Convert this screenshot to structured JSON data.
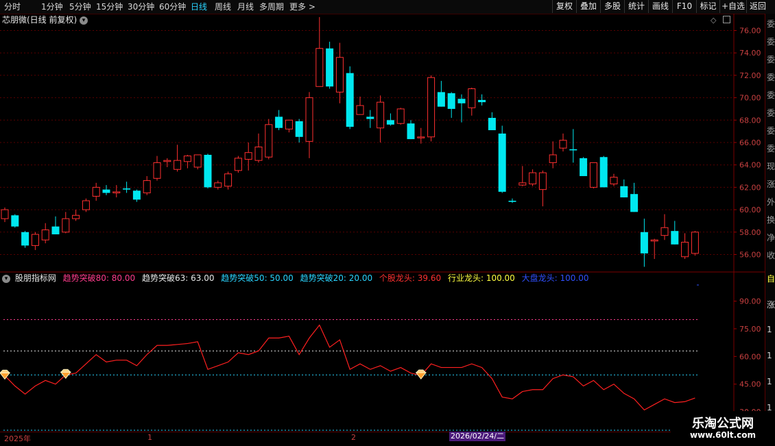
{
  "toolbar": {
    "left_items": [
      "分时",
      "1分钟",
      "5分钟",
      "15分钟",
      "30分钟",
      "60分钟",
      "日线",
      "周线",
      "月线",
      "多周期",
      "更多 >"
    ],
    "active": "日线",
    "right_items": [
      "复权",
      "叠加",
      "多股",
      "统计",
      "画线",
      "F10",
      "标记",
      "+自选",
      "返回"
    ]
  },
  "stock": {
    "title": "芯朋微(日线 前复权)"
  },
  "main_chart": {
    "y_ticks": [
      "76.00",
      "74.00",
      "72.00",
      "70.00",
      "68.00",
      "66.00",
      "64.00",
      "62.00",
      "60.00",
      "58.00",
      "56.00"
    ]
  },
  "indicator": {
    "name": "股朋指标网",
    "items": [
      {
        "label": "趋势突破80: 80.00",
        "color": "#ff3c8c"
      },
      {
        "label": "趋势突破63: 63.00",
        "color": "#e8e8e8"
      },
      {
        "label": "趋势突破50: 50.00",
        "color": "#2ad4ff"
      },
      {
        "label": "趋势突破20: 20.00",
        "color": "#2ad4ff"
      },
      {
        "label": "个股龙头: 39.60",
        "color": "#ff3030"
      },
      {
        "label": "行业龙头: 100.00",
        "color": "#ffff40"
      },
      {
        "label": "大盘龙头: 100.00",
        "color": "#3050ff"
      }
    ],
    "y_ticks": [
      "90.00",
      "75.00",
      "60.00",
      "45.00",
      "30.00"
    ]
  },
  "chart_data": {
    "type": "candlestick",
    "ylim": [
      54.5,
      77.5
    ],
    "candles": [
      {
        "o": 59.2,
        "h": 60.2,
        "l": 58.9,
        "c": 60.0
      },
      {
        "o": 59.5,
        "h": 59.6,
        "l": 58.4,
        "c": 58.5
      },
      {
        "o": 58.0,
        "h": 58.1,
        "l": 56.6,
        "c": 56.8
      },
      {
        "o": 56.8,
        "h": 58.0,
        "l": 56.4,
        "c": 57.8
      },
      {
        "o": 57.3,
        "h": 58.8,
        "l": 57.0,
        "c": 58.2
      },
      {
        "o": 58.5,
        "h": 59.4,
        "l": 57.8,
        "c": 57.8
      },
      {
        "o": 58.0,
        "h": 59.8,
        "l": 57.9,
        "c": 59.2
      },
      {
        "o": 59.2,
        "h": 60.0,
        "l": 59.0,
        "c": 59.5
      },
      {
        "o": 60.0,
        "h": 61.0,
        "l": 59.8,
        "c": 60.8
      },
      {
        "o": 61.2,
        "h": 62.4,
        "l": 60.8,
        "c": 62.0
      },
      {
        "o": 61.8,
        "h": 62.2,
        "l": 61.3,
        "c": 61.5
      },
      {
        "o": 61.5,
        "h": 62.2,
        "l": 61.1,
        "c": 61.6
      },
      {
        "o": 61.9,
        "h": 62.5,
        "l": 61.5,
        "c": 61.8
      },
      {
        "o": 61.7,
        "h": 61.8,
        "l": 60.7,
        "c": 60.9
      },
      {
        "o": 61.5,
        "h": 63.0,
        "l": 61.3,
        "c": 62.6
      },
      {
        "o": 62.8,
        "h": 64.8,
        "l": 62.6,
        "c": 64.2
      },
      {
        "o": 64.3,
        "h": 64.6,
        "l": 63.8,
        "c": 64.4
      },
      {
        "o": 63.6,
        "h": 65.8,
        "l": 63.4,
        "c": 64.4
      },
      {
        "o": 64.3,
        "h": 64.9,
        "l": 63.7,
        "c": 64.8
      },
      {
        "o": 63.8,
        "h": 64.9,
        "l": 63.6,
        "c": 64.9
      },
      {
        "o": 64.9,
        "h": 65.0,
        "l": 61.9,
        "c": 62.0
      },
      {
        "o": 62.0,
        "h": 62.6,
        "l": 61.8,
        "c": 62.4
      },
      {
        "o": 62.1,
        "h": 63.4,
        "l": 61.8,
        "c": 63.2
      },
      {
        "o": 63.5,
        "h": 64.8,
        "l": 63.3,
        "c": 64.6
      },
      {
        "o": 64.5,
        "h": 66.0,
        "l": 63.5,
        "c": 65.1
      },
      {
        "o": 64.4,
        "h": 66.8,
        "l": 64.2,
        "c": 65.6
      },
      {
        "o": 64.7,
        "h": 68.1,
        "l": 64.5,
        "c": 67.6
      },
      {
        "o": 68.3,
        "h": 68.9,
        "l": 67.1,
        "c": 67.3
      },
      {
        "o": 67.2,
        "h": 68.0,
        "l": 66.9,
        "c": 68.0
      },
      {
        "o": 67.9,
        "h": 68.1,
        "l": 66.0,
        "c": 66.5
      },
      {
        "o": 66.1,
        "h": 70.5,
        "l": 64.6,
        "c": 70.0
      },
      {
        "o": 71.0,
        "h": 77.2,
        "l": 71.0,
        "c": 74.4
      },
      {
        "o": 74.4,
        "h": 75.0,
        "l": 70.8,
        "c": 71.0
      },
      {
        "o": 70.5,
        "h": 74.9,
        "l": 69.5,
        "c": 73.6
      },
      {
        "o": 72.2,
        "h": 72.8,
        "l": 67.2,
        "c": 67.4
      },
      {
        "o": 68.5,
        "h": 70.1,
        "l": 68.5,
        "c": 69.3
      },
      {
        "o": 68.3,
        "h": 68.9,
        "l": 67.3,
        "c": 68.1
      },
      {
        "o": 67.3,
        "h": 70.2,
        "l": 66.0,
        "c": 69.6
      },
      {
        "o": 68.0,
        "h": 68.6,
        "l": 67.5,
        "c": 67.6
      },
      {
        "o": 67.7,
        "h": 69.1,
        "l": 67.6,
        "c": 69.0
      },
      {
        "o": 67.7,
        "h": 68.0,
        "l": 66.3,
        "c": 66.3
      },
      {
        "o": 66.5,
        "h": 67.3,
        "l": 65.9,
        "c": 66.5
      },
      {
        "o": 66.5,
        "h": 72.0,
        "l": 66.1,
        "c": 71.8
      },
      {
        "o": 70.5,
        "h": 71.5,
        "l": 69.2,
        "c": 69.2
      },
      {
        "o": 70.4,
        "h": 70.5,
        "l": 68.2,
        "c": 69.0
      },
      {
        "o": 69.9,
        "h": 70.3,
        "l": 67.8,
        "c": 69.5
      },
      {
        "o": 69.1,
        "h": 70.9,
        "l": 68.4,
        "c": 70.8
      },
      {
        "o": 69.8,
        "h": 70.3,
        "l": 69.3,
        "c": 69.6
      },
      {
        "o": 68.2,
        "h": 68.7,
        "l": 67.1,
        "c": 67.1
      },
      {
        "o": 66.8,
        "h": 67.5,
        "l": 61.5,
        "c": 61.6
      },
      {
        "o": 60.8,
        "h": 61.0,
        "l": 60.6,
        "c": 60.7
      },
      {
        "o": 62.2,
        "h": 63.9,
        "l": 62.1,
        "c": 62.4
      },
      {
        "o": 62.3,
        "h": 63.6,
        "l": 62.1,
        "c": 63.3
      },
      {
        "o": 61.8,
        "h": 63.5,
        "l": 60.3,
        "c": 63.3
      },
      {
        "o": 64.2,
        "h": 66.1,
        "l": 63.7,
        "c": 64.9
      },
      {
        "o": 65.5,
        "h": 66.8,
        "l": 65.2,
        "c": 66.2
      },
      {
        "o": 65.4,
        "h": 67.2,
        "l": 64.2,
        "c": 65.3
      },
      {
        "o": 64.6,
        "h": 64.7,
        "l": 63.0,
        "c": 63.0
      },
      {
        "o": 62.0,
        "h": 64.2,
        "l": 61.9,
        "c": 64.2
      },
      {
        "o": 64.7,
        "h": 64.8,
        "l": 62.0,
        "c": 62.0
      },
      {
        "o": 62.3,
        "h": 63.2,
        "l": 62.1,
        "c": 62.9
      },
      {
        "o": 62.1,
        "h": 62.7,
        "l": 61.1,
        "c": 61.1
      },
      {
        "o": 61.4,
        "h": 62.4,
        "l": 59.8,
        "c": 59.8
      },
      {
        "o": 58.0,
        "h": 59.2,
        "l": 54.9,
        "c": 56.1
      },
      {
        "o": 57.2,
        "h": 57.4,
        "l": 55.6,
        "c": 57.3
      },
      {
        "o": 57.7,
        "h": 59.6,
        "l": 57.3,
        "c": 58.4
      },
      {
        "o": 58.1,
        "h": 59.0,
        "l": 56.9,
        "c": 56.9
      },
      {
        "o": 55.8,
        "h": 57.9,
        "l": 55.6,
        "c": 57.1
      },
      {
        "o": 56.1,
        "h": 58.1,
        "l": 55.9,
        "c": 58.0
      }
    ],
    "indicator_ylim": [
      20,
      98
    ],
    "indicator_levels": [
      80,
      63,
      50,
      20
    ],
    "indicator_line": [
      49.6,
      44,
      39.6,
      44,
      47,
      45,
      50,
      51,
      56,
      61,
      57,
      58,
      58,
      55,
      61,
      66,
      66,
      66.5,
      67,
      68,
      53,
      55,
      57,
      62,
      61,
      63,
      70,
      70,
      71,
      61,
      70,
      77,
      65,
      69,
      53,
      56,
      53,
      55,
      52,
      54,
      51,
      49.7,
      56,
      54,
      54,
      54,
      56,
      54,
      48,
      38,
      37,
      41,
      42,
      42,
      48,
      50,
      49,
      44,
      47,
      42,
      45,
      40,
      37,
      31,
      34,
      37,
      35,
      35.5,
      37.5
    ],
    "diamond_markers": [
      0,
      6,
      41
    ],
    "x_labels": [
      "2025年",
      "1",
      "2"
    ]
  },
  "date_axis": {
    "cursor_date": "2026/02/24/二"
  },
  "right_strip": {
    "chars": [
      "委",
      "委",
      "委",
      "委",
      "委",
      "委",
      "委",
      "委",
      "现",
      "涨",
      "外",
      "换",
      "净",
      "收"
    ],
    "chars_low": [
      "自",
      "涨",
      "1",
      "1",
      "1",
      "1"
    ]
  },
  "watermark": {
    "title": "乐淘公式网",
    "url": "www.60lt.com"
  }
}
